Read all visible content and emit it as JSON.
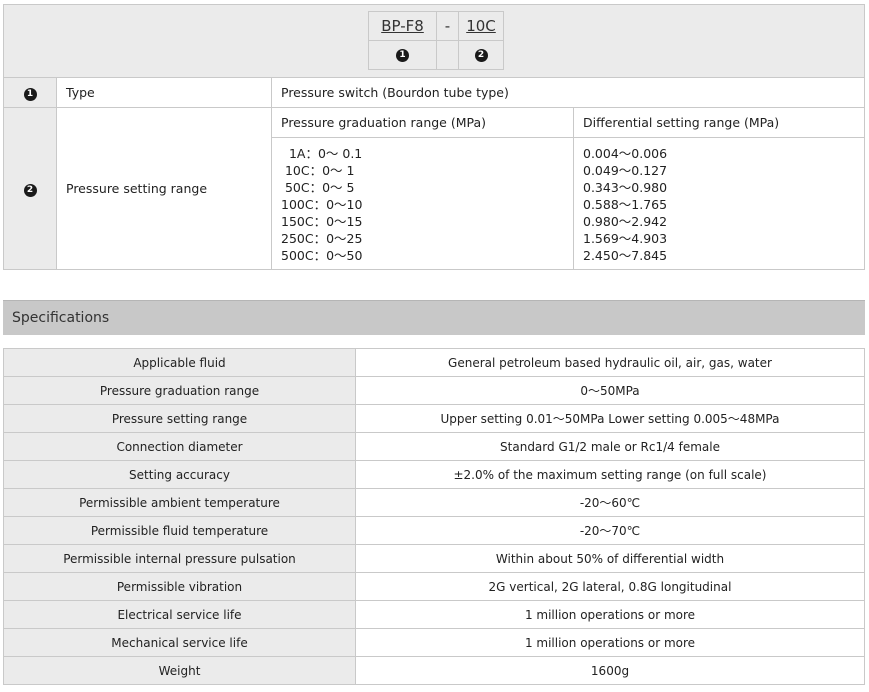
{
  "model_code": {
    "part1": "BP-F8",
    "sep": "-",
    "part2": "10C",
    "marker1": "1",
    "marker2": "2"
  },
  "options": [
    {
      "marker": "1",
      "label": "Type",
      "value": "Pressure switch (Bourdon tube type)"
    },
    {
      "marker": "2",
      "label": "Pressure setting range",
      "col1_header": "Pressure graduation range (MPa)",
      "col2_header": "Differential setting range (MPa)",
      "graduation": [
        "  1A：0～ 0.1",
        " 10C：0～ 1",
        " 50C：0～ 5",
        "100C：0～10",
        "150C：0～15",
        "250C：0～25",
        "500C：0～50"
      ],
      "differential": [
        "0.004～0.006",
        "0.049～0.127",
        "0.343～0.980",
        "0.588～1.765",
        "0.980～2.942",
        "1.569～4.903",
        "2.450～7.845"
      ]
    }
  ],
  "specifications": {
    "title": "Specifications",
    "rows": [
      {
        "key": "Applicable fluid",
        "value": "General petroleum based hydraulic oil, air, gas, water"
      },
      {
        "key": "Pressure graduation range",
        "value": "0～50MPa"
      },
      {
        "key": "Pressure setting range",
        "value": "Upper setting 0.01～50MPa Lower setting 0.005～48MPa"
      },
      {
        "key": "Connection diameter",
        "value": "Standard G1/2 male or Rc1/4 female"
      },
      {
        "key": "Setting accuracy",
        "value": "±2.0% of the maximum setting range (on full scale)"
      },
      {
        "key": "Permissible ambient temperature",
        "value": "-20～60℃"
      },
      {
        "key": "Permissible fluid temperature",
        "value": "-20～70℃"
      },
      {
        "key": "Permissible internal pressure pulsation",
        "value": "Within about 50% of differential width"
      },
      {
        "key": "Permissible vibration",
        "value": "2G vertical, 2G lateral, 0.8G longitudinal"
      },
      {
        "key": "Electrical service life",
        "value": "1 million operations or more"
      },
      {
        "key": "Mechanical service life",
        "value": "1 million operations or more"
      },
      {
        "key": "Weight",
        "value": "1600g"
      }
    ]
  }
}
